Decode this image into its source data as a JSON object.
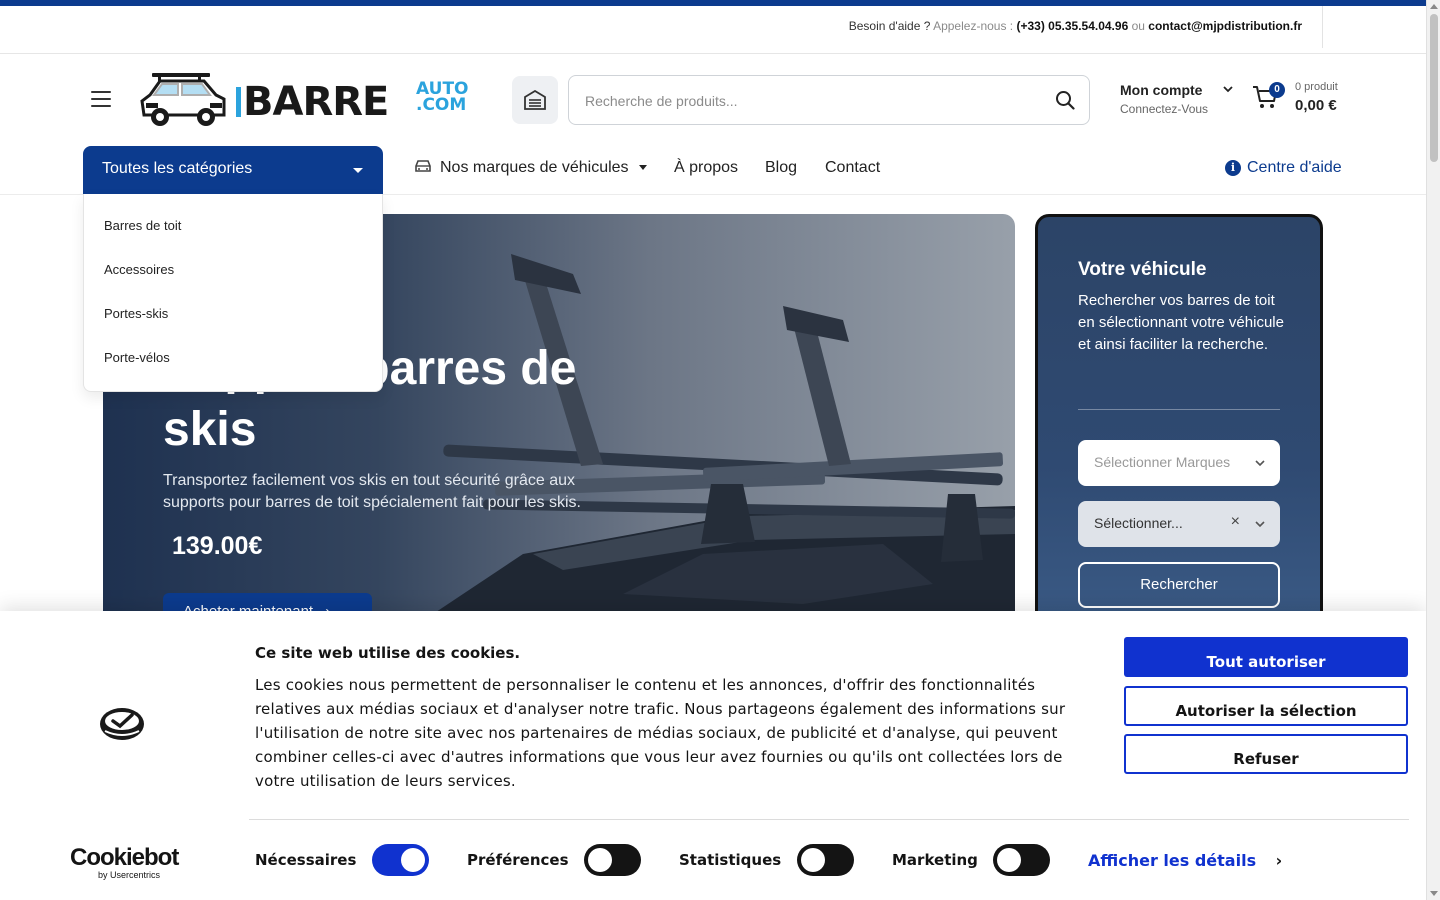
{
  "topbar": {
    "help_prefix": "Besoin d'aide ?",
    "call_label": "Appelez-nous :",
    "phone": "(+33) 05.35.54.04.96",
    "or_label": "ou",
    "email": "contact@mjpdistribution.fr"
  },
  "header": {
    "logo_brand": "BARRE",
    "logo_auto": "AUTO",
    "logo_com": ".COM",
    "search_placeholder": "Recherche de produits...",
    "account_title": "Mon compte",
    "account_subtitle": "Connectez-Vous",
    "cart_badge": "0",
    "cart_count": "0 produit",
    "cart_total": "0,00 €"
  },
  "nav": {
    "categories_button": "Toutes les catégories",
    "brands": "Nos marques de véhicules",
    "about": "À propos",
    "blog": "Blog",
    "contact": "Contact",
    "help_center": "Centre d'aide"
  },
  "category_menu": [
    "Barres de toit",
    "Accessoires",
    "Portes-skis",
    "Porte-vélos"
  ],
  "hero": {
    "title": "Support barres de skis",
    "description": "Transportez facilement vos skis en tout sécurité grâce aux supports pour barres de toit spécialement fait pour les skis.",
    "price": "139.00€",
    "cta": "Acheter maintenant"
  },
  "vehicle": {
    "title": "Votre véhicule",
    "description": "Rechercher vos barres de toit en sélectionnant votre véhicule et ainsi faciliter la recherche.",
    "brand_placeholder": "Sélectionner Marques",
    "model_value": "Sélectionner...",
    "clear": "×",
    "search_button": "Rechercher"
  },
  "cookie": {
    "title": "Ce site web utilise des cookies.",
    "text": "Les cookies nous permettent de personnaliser le contenu et les annonces, d'offrir des fonctionnalités relatives aux médias sociaux et d'analyser notre trafic. Nous partageons également des informations sur l'utilisation de notre site avec nos partenaires de médias sociaux, de publicité et d'analyse, qui peuvent combiner celles-ci avec d'autres informations que vous leur avez fournies ou qu'ils ont collectées lors de votre utilisation de leurs services.",
    "allow_all": "Tout autoriser",
    "allow_selection": "Autoriser la sélection",
    "refuse": "Refuser",
    "brand_big": "Cookiebot",
    "brand_small": "by Usercentrics",
    "toggles": [
      {
        "label": "Nécessaires",
        "on": true
      },
      {
        "label": "Préférences",
        "on": false
      },
      {
        "label": "Statistiques",
        "on": false
      },
      {
        "label": "Marketing",
        "on": false
      }
    ],
    "details_link": "Afficher les détails"
  },
  "colors": {
    "primary": "#0c3b8e",
    "logo_accent": "#2ba3dd",
    "cookie_blue": "#1032cf"
  }
}
